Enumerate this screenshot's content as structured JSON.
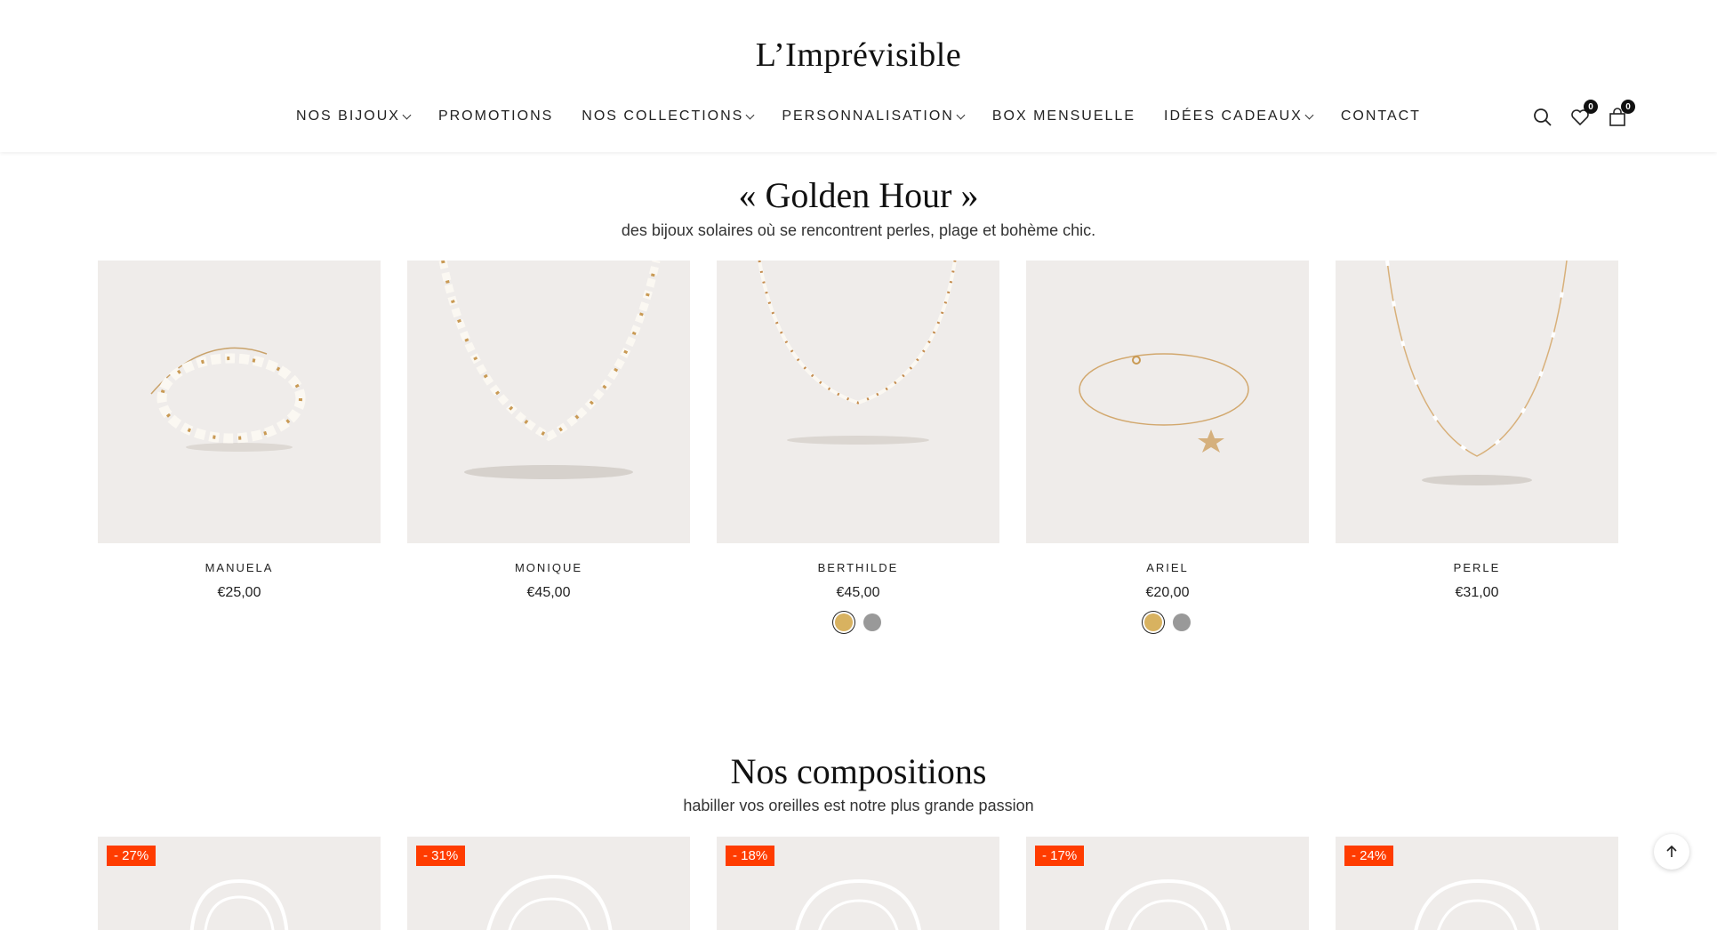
{
  "header": {
    "logo": "L’Imprévisible",
    "nav": [
      {
        "label": "NOS BIJOUX",
        "dropdown": true
      },
      {
        "label": "PROMOTIONS",
        "dropdown": false
      },
      {
        "label": "NOS COLLECTIONS",
        "dropdown": true
      },
      {
        "label": "PERSONNALISATION",
        "dropdown": true
      },
      {
        "label": "BOX MENSUELLE",
        "dropdown": false
      },
      {
        "label": "IDÉES CADEAUX",
        "dropdown": true
      },
      {
        "label": "CONTACT",
        "dropdown": false
      }
    ],
    "wishlist_count": "0",
    "cart_count": "0"
  },
  "golden_hour": {
    "title": "« Golden Hour »",
    "subtitle": "des bijoux solaires où se rencontrent perles, plage et bohème chic.",
    "products": [
      {
        "name": "MANUELA",
        "price": "€25,00",
        "swatches": []
      },
      {
        "name": "MONIQUE",
        "price": "€45,00",
        "swatches": []
      },
      {
        "name": "BERTHILDE",
        "price": "€45,00",
        "swatches": [
          "#d8b260",
          "#999999"
        ]
      },
      {
        "name": "ARIEL",
        "price": "€20,00",
        "swatches": [
          "#d8b260",
          "#999999"
        ]
      },
      {
        "name": "PERLE",
        "price": "€31,00",
        "swatches": []
      }
    ]
  },
  "compositions": {
    "title": "Nos compositions",
    "subtitle": "habiller vos oreilles est notre plus grande passion",
    "discounts": [
      "- 27%",
      "- 31%",
      "- 18%",
      "- 17%",
      "- 24%"
    ]
  },
  "colors": {
    "accent": "#ff3c00",
    "thumb_bg": "#efecea",
    "gold": "#d8b260"
  }
}
